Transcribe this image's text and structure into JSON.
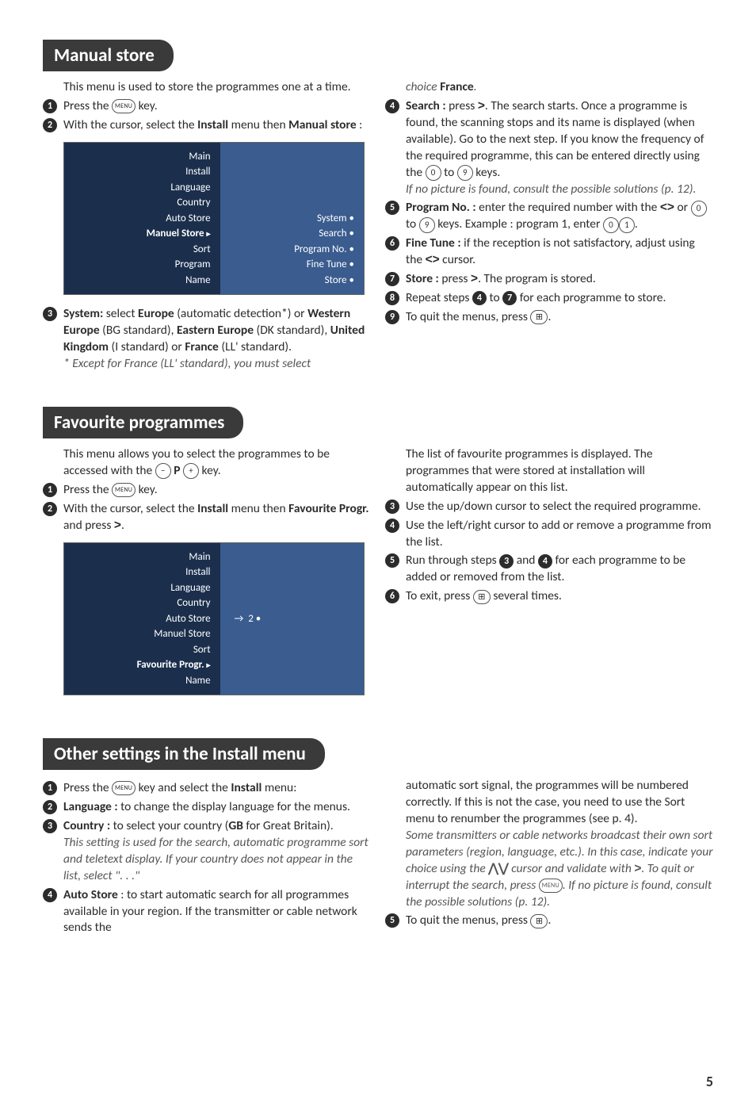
{
  "sec1": {
    "title": "Manual store",
    "intro": "This menu is used to store the programmes one at a time.",
    "step1": "Press the ",
    "step1b": " key.",
    "step2a": "With the cursor, select the ",
    "step2b": "Install",
    "step2c": " menu then ",
    "step2d": "Manual store",
    "step2e": " :",
    "menu_left": [
      "Main",
      "Install",
      "Language",
      "Country",
      "Auto Store",
      "Manuel Store",
      "Sort",
      "Program",
      "Name"
    ],
    "menu_right": [
      "System",
      "Search",
      "Program No.",
      "Fine Tune",
      "Store"
    ],
    "step3a": "System:",
    "step3b": " select ",
    "step3c": "Europe",
    "step3d": " (automatic detection*) or ",
    "step3e": "Western Europe",
    "step3f": " (BG standard), ",
    "step3g": "Eastern Europe",
    "step3h": " (DK standard), ",
    "step3i": "United Kingdom",
    "step3j": " (I standard) or ",
    "step3k": "France",
    "step3l": " (LL' standard).",
    "step3note": "* Except for France (LL' standard), you must select ",
    "choice_pre": "choice ",
    "choice": "France",
    "choice_post": ".",
    "step4a": "Search :",
    "step4b": " press ",
    "step4c": ". The search starts. Once a programme is found, the scanning stops and its name is displayed (when available). Go to the next step. If you know the frequency of the required programme, this can be entered directly using the ",
    "step4d": " to ",
    "step4e": " keys.",
    "step4note": "If no picture is found, consult the possible solutions (p. 12).",
    "step5a": "Program No. :",
    "step5b": " enter the required number with the ",
    "step5c": " or ",
    "step5d": " to ",
    "step5e": " keys. Example : program 1, enter ",
    "step5f": ".",
    "step6a": "Fine Tune :",
    "step6b": " if the reception is not satisfactory, adjust using the ",
    "step6c": " cursor.",
    "step7a": "Store :",
    "step7b": " press ",
    "step7c": ". The program is stored.",
    "step8a": "Repeat steps ",
    "step8b": " to ",
    "step8c": " for each programme to store.",
    "step9a": "To quit the menus, press ",
    "step9b": ".",
    "k0": "0",
    "k1": "1",
    "k9": "9",
    "menu": "MENU",
    "exit": "⊞"
  },
  "sec2": {
    "title": "Favourite programmes",
    "intro_a": "This menu allows you to select the programmes to be accessed with the ",
    "intro_b": " key.",
    "minus": "−",
    "plus": "+",
    "P": "P",
    "step1": "Press the ",
    "step1b": " key.",
    "step2a": "With the cursor, select the ",
    "step2b": "Install",
    "step2c": " menu then ",
    "step2d": "Favourite Progr.",
    "step2e": " and press ",
    "step2f": ".",
    "menu_left": [
      "Main",
      "Install",
      "Language",
      "Country",
      "Auto Store",
      "Manuel Store",
      "Sort",
      "Favourite Progr.",
      "Name"
    ],
    "menu_right_val": "2",
    "r1": "The list of favourite programmes is displayed. The programmes that were stored at installation will automatically appear on this list.",
    "step3": "Use the up/down cursor to select the required programme.",
    "step4": "Use the left/right cursor to add or remove a programme from the list.",
    "step5a": "Run through steps ",
    "step5b": " and ",
    "step5c": " for each programme to be added or removed from the list.",
    "step6a": "To exit, press ",
    "step6b": " several times."
  },
  "sec3": {
    "title": "Other settings in the Install menu",
    "step1a": "Press the ",
    "step1b": " key and select the ",
    "step1c": "Install",
    "step1d": " menu:",
    "step2a": "Language :",
    "step2b": " to change the display language for the menus.",
    "step3a": "Country :",
    "step3b": " to select your country (",
    "step3c": "GB",
    "step3d": " for Great Britain).",
    "step3note": "This setting is used for the search, automatic programme sort and teletext display. If your country does not appear in the list, select \". . .\"",
    "step4a": "Auto Store",
    "step4b": " : to start automatic search for all programmes available in your region. If the transmitter or cable network sends the ",
    "r1": "automatic sort signal, the programmes will be numbered correctly. If this is not the case, you need to use the Sort menu to renumber the programmes (see p. 4).",
    "rnote_a": "Some transmitters or cable networks broadcast their own sort parameters (region, language, etc.). In this case, indicate your choice using the ",
    "rnote_b": " cursor and validate with ",
    "rnote_c": ". To quit or interrupt the search, press ",
    "rnote_d": ". If no picture is found, consult the possible solutions (p. 12).",
    "step5a": "To quit the menus, press ",
    "step5b": "."
  },
  "page": "5"
}
